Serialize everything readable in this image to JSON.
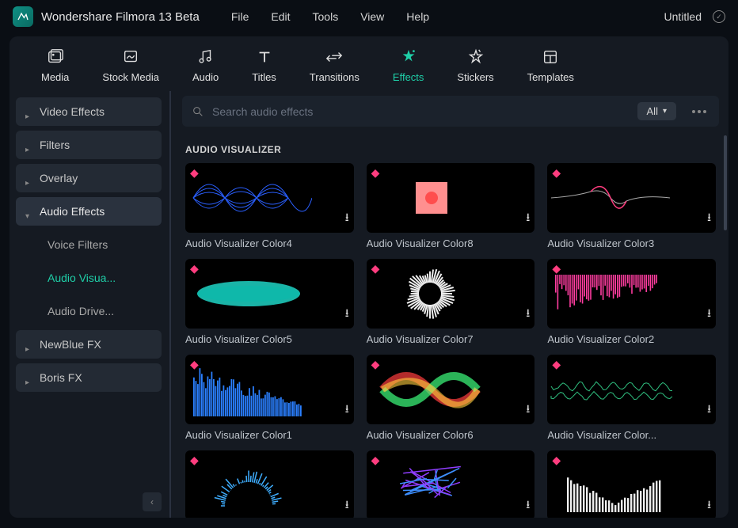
{
  "app": {
    "title": "Wondershare Filmora 13 Beta",
    "doc": "Untitled"
  },
  "menu": [
    "File",
    "Edit",
    "Tools",
    "View",
    "Help"
  ],
  "tabs": [
    {
      "label": "Media"
    },
    {
      "label": "Stock Media"
    },
    {
      "label": "Audio"
    },
    {
      "label": "Titles"
    },
    {
      "label": "Transitions"
    },
    {
      "label": "Effects",
      "active": true
    },
    {
      "label": "Stickers"
    },
    {
      "label": "Templates"
    }
  ],
  "sidebar": {
    "items": [
      {
        "label": "Video Effects",
        "expanded": false
      },
      {
        "label": "Filters",
        "expanded": false
      },
      {
        "label": "Overlay",
        "expanded": false
      },
      {
        "label": "Audio Effects",
        "expanded": true,
        "subs": [
          {
            "label": "Voice Filters"
          },
          {
            "label": "Audio Visua...",
            "active": true
          },
          {
            "label": "Audio Drive..."
          }
        ]
      },
      {
        "label": "NewBlue FX",
        "expanded": false
      },
      {
        "label": "Boris FX",
        "expanded": false
      }
    ]
  },
  "search": {
    "placeholder": "Search audio effects",
    "filter": "All"
  },
  "section": "AUDIO VISUALIZER",
  "cards": [
    {
      "label": "Audio Visualizer Color4",
      "viz": "wave-blue"
    },
    {
      "label": "Audio Visualizer Color8",
      "viz": "square-pink"
    },
    {
      "label": "Audio Visualizer Color3",
      "viz": "line-pink"
    },
    {
      "label": "Audio Visualizer Color5",
      "viz": "spectrum-cyan"
    },
    {
      "label": "Audio Visualizer Color7",
      "viz": "radial-white"
    },
    {
      "label": "Audio Visualizer Color2",
      "viz": "bars-pink"
    },
    {
      "label": "Audio Visualizer Color1",
      "viz": "bars-blue"
    },
    {
      "label": "Audio Visualizer Color6",
      "viz": "ribbon-multi"
    },
    {
      "label": "Audio Visualizer Color...",
      "viz": "wave-green"
    },
    {
      "label": "",
      "viz": "arc-blue"
    },
    {
      "label": "",
      "viz": "scratch-purple"
    },
    {
      "label": "",
      "viz": "bars-white"
    }
  ]
}
